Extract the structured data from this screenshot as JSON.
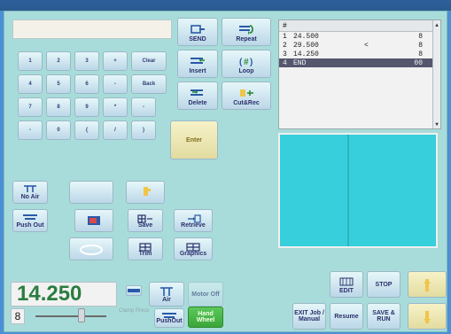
{
  "display": {
    "value": ""
  },
  "toolbar": {
    "send": "SEND",
    "repeat": "Repeat",
    "insert": "Insert",
    "loop": "Loop",
    "delete": "Delete",
    "cut_rec": "Cut&Rec",
    "enter": "Enter"
  },
  "keypad": {
    "row1": [
      "1",
      "2",
      "3",
      "+",
      "Clear"
    ],
    "row2": [
      "4",
      "5",
      "6",
      "-",
      "Back"
    ],
    "row3": [
      "7",
      "8",
      "9",
      "*",
      "-"
    ],
    "row4": [
      "-",
      "0",
      "(",
      "/",
      ")"
    ]
  },
  "left_buttons": {
    "no_air": "No Air",
    "push_out": "Push Out",
    "save": "Save",
    "retrieve": "Retrieve",
    "trim": "Trim",
    "graphics": "Graphics"
  },
  "table": {
    "header": [
      "#",
      "",
      "",
      ""
    ],
    "rows": [
      {
        "id": "1",
        "value": "24.500",
        "flag": "",
        "count": "8",
        "selected": false
      },
      {
        "id": "2",
        "value": "29.500",
        "flag": "<",
        "count": "8",
        "selected": false
      },
      {
        "id": "3",
        "value": "14.250",
        "flag": "",
        "count": "8",
        "selected": false
      },
      {
        "id": "4",
        "value": "END",
        "flag": "",
        "count": "00",
        "selected": true
      }
    ]
  },
  "status": {
    "big_value": "14.250",
    "small_value": "8",
    "motor": "Motor Off",
    "hand_wheel": "Hand Wheel",
    "clamp_press": "Clamp Press",
    "air": "Air",
    "push_out_small": "PushOut"
  },
  "bottom_right": {
    "edit": "EDIT",
    "stop": "STOP",
    "exit_job": "EXIT Job / Manual",
    "resume": "Resume",
    "save_run": "SAVE & RUN"
  },
  "colors": {
    "panel_bg": "#a8dcda",
    "preview_bg": "#37cfdb",
    "green_value": "#2a7d3f",
    "hand_wheel_green": "#45b845"
  }
}
